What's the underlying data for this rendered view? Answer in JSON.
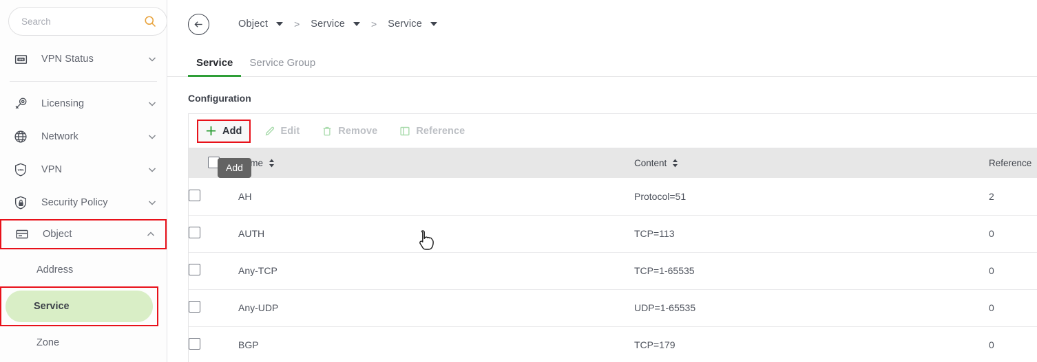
{
  "sidebar": {
    "search": {
      "placeholder": "Search",
      "value": "",
      "icon": "search-icon"
    },
    "collapse_icon": "collapse-sidebar-icon",
    "top_items": [
      {
        "label": "VPN Status",
        "icon": "vpn-badge-icon",
        "chevron": "chevron-down-icon"
      }
    ],
    "items": [
      {
        "label": "Licensing",
        "icon": "key-icon",
        "chevron": "chevron-down-icon"
      },
      {
        "label": "Network",
        "icon": "globe-icon",
        "chevron": "chevron-down-icon"
      },
      {
        "label": "VPN",
        "icon": "shield-vpn-icon",
        "chevron": "chevron-down-icon"
      },
      {
        "label": "Security Policy",
        "icon": "shield-lock-icon",
        "chevron": "chevron-down-icon"
      },
      {
        "label": "Object",
        "icon": "object-card-icon",
        "chevron": "chevron-up-icon"
      }
    ],
    "sub_items": [
      {
        "label": "Address"
      },
      {
        "label": "Service"
      },
      {
        "label": "Zone"
      }
    ]
  },
  "header": {
    "back_icon": "back-arrow-icon",
    "breadcrumb": [
      {
        "label": "Object"
      },
      {
        "label": "Service"
      },
      {
        "label": "Service"
      }
    ],
    "separator": ">"
  },
  "tabs": [
    {
      "label": "Service",
      "active": true
    },
    {
      "label": "Service Group",
      "active": false
    }
  ],
  "section": {
    "title": "Configuration"
  },
  "toolbar": {
    "add_label": "Add",
    "edit_label": "Edit",
    "remove_label": "Remove",
    "reference_label": "Reference",
    "tooltip": "Add"
  },
  "table": {
    "columns": [
      {
        "key": "name",
        "label": "Name",
        "sortable": true
      },
      {
        "key": "content",
        "label": "Content",
        "sortable": true
      },
      {
        "key": "reference",
        "label": "Reference",
        "sortable": true
      }
    ],
    "rows": [
      {
        "name": "AH",
        "content": "Protocol=51",
        "reference": "2"
      },
      {
        "name": "AUTH",
        "content": "TCP=113",
        "reference": "0"
      },
      {
        "name": "Any-TCP",
        "content": "TCP=1-65535",
        "reference": "0"
      },
      {
        "name": "Any-UDP",
        "content": "UDP=1-65535",
        "reference": "0"
      },
      {
        "name": "BGP",
        "content": "TCP=179",
        "reference": "0"
      }
    ]
  },
  "colors": {
    "accent_green": "#2e9e37",
    "highlight_red": "#e8111a",
    "selected_bg": "#d9eec6",
    "search_icon": "#e8a33d",
    "header_bg": "#e7e7e7"
  }
}
